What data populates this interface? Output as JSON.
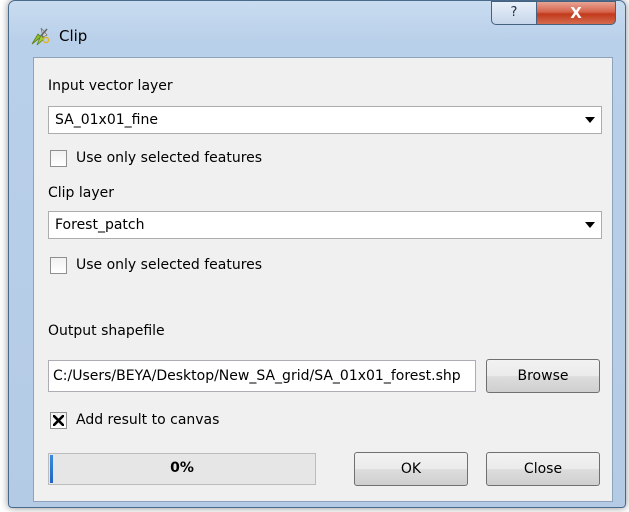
{
  "window": {
    "title": "Clip",
    "help_glyph": "?",
    "close_glyph": "X"
  },
  "form": {
    "input_layer": {
      "label": "Input vector layer",
      "value": "SA_01x01_fine",
      "selected_only_label": "Use only selected features",
      "selected_only_checked": false
    },
    "clip_layer": {
      "label": "Clip layer",
      "value": "Forest_patch",
      "selected_only_label": "Use only selected features",
      "selected_only_checked": false
    },
    "output": {
      "label": "Output shapefile",
      "value": "C:/Users/BEYA/Desktop/New_SA_grid/SA_01x01_forest.shp",
      "browse_label": "Browse"
    },
    "add_to_canvas": {
      "label": "Add result to canvas",
      "checked": true
    }
  },
  "footer": {
    "progress_text": "0%",
    "progress_percent": 0,
    "ok_label": "OK",
    "close_label": "Close"
  },
  "icons": {
    "app": "qgis-clip-icon",
    "combo_arrow": "chevron-down-icon",
    "check": "check-x-icon"
  }
}
